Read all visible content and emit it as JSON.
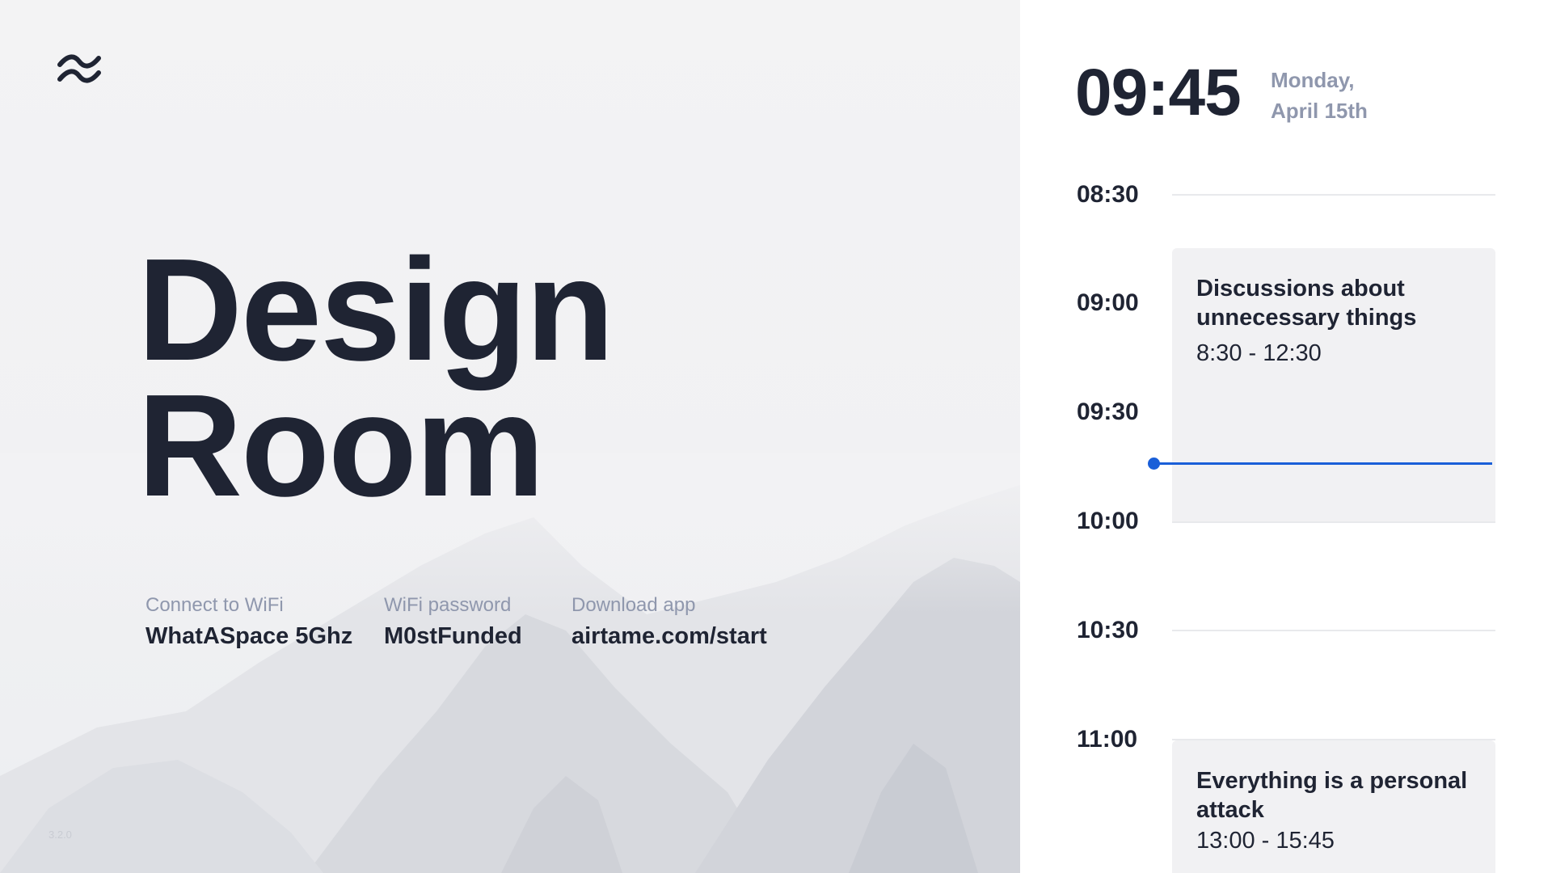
{
  "left": {
    "logo_icon": "approx-waves-icon",
    "title_line1": "Design",
    "title_line2": "Room",
    "info": [
      {
        "label": "Connect to WiFi",
        "value": "WhatASpace 5Ghz"
      },
      {
        "label": "WiFi password",
        "value": "M0stFunded"
      },
      {
        "label": "Download app",
        "value": "airtame.com/start"
      }
    ],
    "version": "3.2.0"
  },
  "right": {
    "clock": "09:45",
    "date_line1": "Monday,",
    "date_line2": "April 15th",
    "timeline": [
      "08:30",
      "09:00",
      "09:30",
      "10:00",
      "10:30",
      "11:00"
    ],
    "events": [
      {
        "title": "Discussions about unnecessary things",
        "time": "8:30 - 12:30"
      },
      {
        "title": "Everything is a personal attack",
        "time": "13:00 - 15:45"
      }
    ],
    "current_time_color": "#1a5fd8"
  },
  "colors": {
    "text_dark": "#1f2433",
    "text_muted": "#8f97ad",
    "event_bg": "#f1f1f3",
    "accent": "#1a5fd8"
  }
}
